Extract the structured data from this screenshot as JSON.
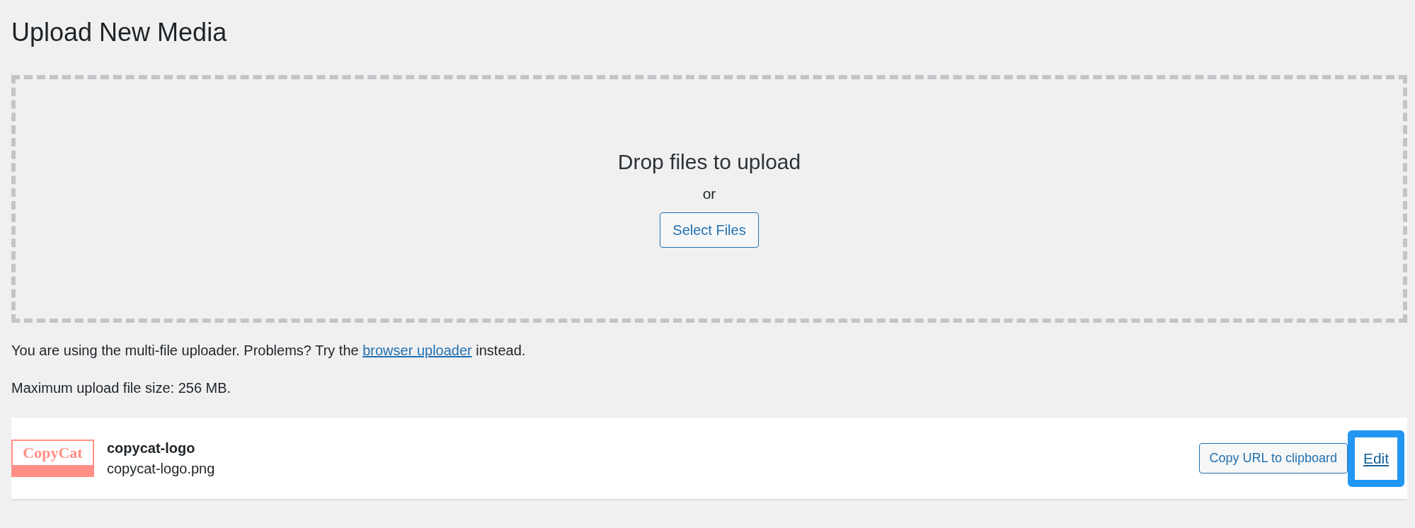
{
  "title": "Upload New Media",
  "dropzone": {
    "heading": "Drop files to upload",
    "or": "or",
    "button": "Select Files"
  },
  "notice": {
    "before": "You are using the multi-file uploader. Problems? Try the",
    "link": "browser uploader",
    "after": "instead."
  },
  "max_size": "Maximum upload file size: 256 MB.",
  "items": [
    {
      "thumbnail": "CopyCat",
      "title": "copycat-logo",
      "filename": "copycat-logo.png",
      "copy_button": "Copy URL to clipboard",
      "edit_link": "Edit",
      "edit_focused": true
    }
  ]
}
